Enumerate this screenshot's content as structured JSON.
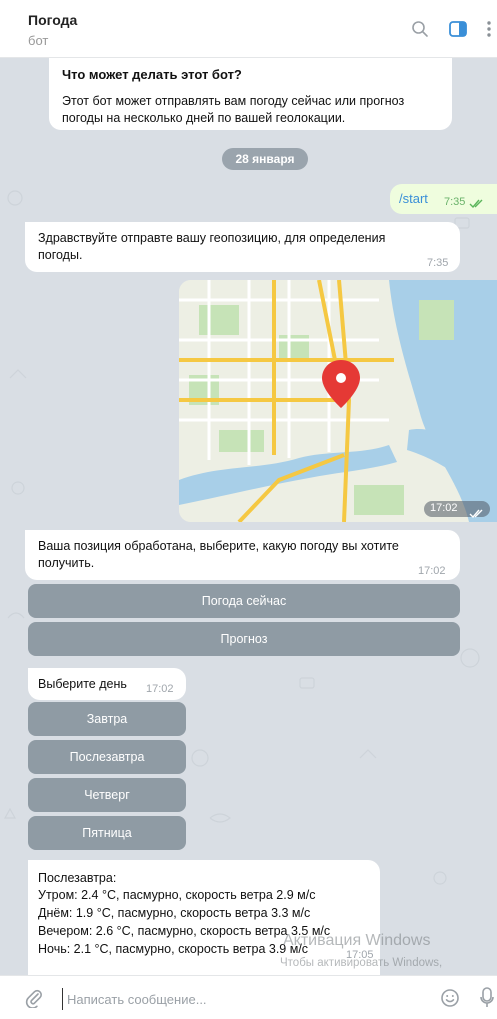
{
  "header": {
    "title": "Погода",
    "status": "бот"
  },
  "intro": {
    "title": "Что может делать этот бот?",
    "text": "Этот бот может отправлять вам погоду сейчас или прогноз погоды на несколько дней по вашей геолокации."
  },
  "date_divider": "28 января",
  "messages": {
    "start": {
      "text": "/start",
      "time": "7:35"
    },
    "greeting": {
      "text": "Здравствуйте отправте вашу геопозицию, для определения погоды.",
      "time": "7:35"
    },
    "location": {
      "time": "17:02"
    },
    "processed": {
      "text": "Ваша позиция обработана, выберите, какую погоду вы хотите получить.",
      "time": "17:02"
    },
    "choose_day": {
      "text": "Выберите день",
      "time": "17:02"
    },
    "forecast": {
      "heading": "Послезавтра:",
      "lines": [
        "Утром: 2.4 °C, пасмурно, скорость ветра 2.9 м/с",
        "Днём: 1.9 °C, пасмурно, скорость ветра 3.3 м/с",
        "Вечером: 2.6 °C, пасмурно, скорость ветра 3.5 м/с",
        "Ночь: 2.1 °C, пасмурно, скорость ветра 3.9 м/с"
      ],
      "time": "17:05"
    }
  },
  "keyboard_main": [
    "Погода сейчас",
    "Прогноз"
  ],
  "keyboard_days": [
    "Завтра",
    "Послезавтра",
    "Четверг",
    "Пятница"
  ],
  "composer": {
    "placeholder": "Написать сообщение..."
  },
  "watermark": {
    "line1": "Активация Windows",
    "line2": "Чтобы активировать Windows,"
  },
  "colors": {
    "accent": "#3a8fd8",
    "outgoing_bubble": "#effdde",
    "keyboard_button": "#8f9ba4",
    "map_pin": "#e53935"
  },
  "icons": [
    "search-icon",
    "sidebar-panel-icon",
    "more-icon",
    "double-check-icon",
    "attach-icon",
    "emoji-icon",
    "microphone-icon",
    "map-pin-icon"
  ]
}
